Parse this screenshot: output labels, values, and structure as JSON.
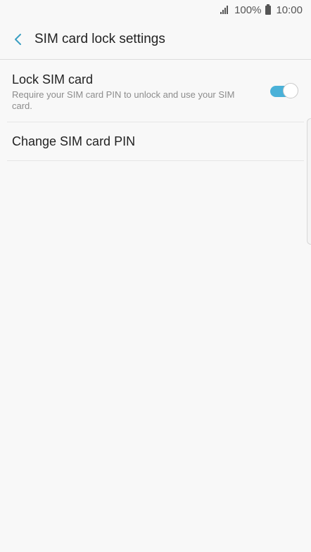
{
  "status_bar": {
    "battery_percent": "100%",
    "time": "10:00"
  },
  "header": {
    "title": "SIM card lock settings"
  },
  "settings": {
    "lock_sim_card": {
      "title": "Lock SIM card",
      "summary": "Require your SIM card PIN to unlock and use your SIM card.",
      "enabled": true
    },
    "change_pin": {
      "title": "Change SIM card PIN"
    }
  },
  "colors": {
    "accent": "#4ab1d8",
    "background": "#f8f8f8",
    "back_arrow": "#3a9fc2"
  },
  "icons": {
    "back": "back-arrow-icon",
    "signal": "signal-icon",
    "battery": "battery-icon"
  }
}
